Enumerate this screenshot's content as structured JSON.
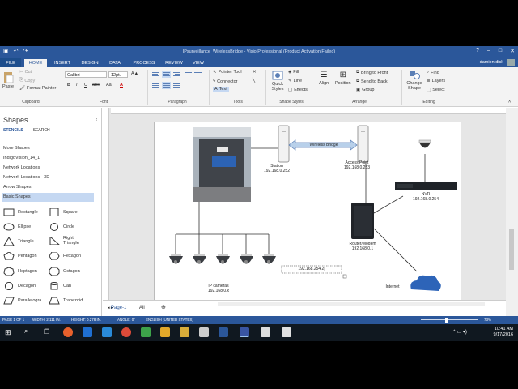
{
  "window": {
    "title": "IPsurveillance_WirelessBridge - Visio Professional (Product Activation Failed)"
  },
  "tabs": [
    "FILE",
    "HOME",
    "INSERT",
    "DESIGN",
    "DATA",
    "PROCESS",
    "REVIEW",
    "VIEW"
  ],
  "user": "damion dick",
  "ribbon": {
    "clipboard": {
      "paste": "Paste",
      "cut": "Cut",
      "copy": "Copy",
      "format_painter": "Format Painter",
      "label": "Clipboard"
    },
    "font": {
      "family": "Calibri",
      "size": "12pt.",
      "bold": "B",
      "italic": "I",
      "underline": "U",
      "strike": "abc",
      "case": "Aa",
      "color": "A",
      "label": "Font"
    },
    "paragraph": {
      "label": "Paragraph"
    },
    "tools": {
      "pointer": "Pointer Tool",
      "connector": "Connector",
      "text": "Text",
      "label": "Tools"
    },
    "shape_styles": {
      "quick_styles": "Quick Styles",
      "fill": "Fill",
      "line": "Line",
      "effects": "Effects",
      "label": "Shape Styles"
    },
    "arrange": {
      "align": "Align",
      "position": "Position",
      "bring_front": "Bring to Front",
      "send_back": "Send to Back",
      "group": "Group",
      "label": "Arrange"
    },
    "editing": {
      "change_shape": "Change Shape",
      "find": "Find",
      "layers": "Layers",
      "select": "Select",
      "label": "Editing"
    }
  },
  "pane": {
    "title": "Shapes",
    "tab_stencils": "STENCILS",
    "tab_search": "SEARCH",
    "stencils": [
      "More Shapes",
      "IndigoVision_14_1",
      "Network Locations",
      "Network Locations - 3D",
      "Arrow Shapes",
      "Basic Shapes"
    ],
    "shapes": [
      [
        "Rectangle",
        "Square"
      ],
      [
        "Ellipse",
        "Circle"
      ],
      [
        "Triangle",
        "Right Triangle"
      ],
      [
        "Pentagon",
        "Hexagon"
      ],
      [
        "Heptagon",
        "Octagon"
      ],
      [
        "Decagon",
        "Can"
      ],
      [
        "Parallelogra...",
        "Trapezoid"
      ]
    ]
  },
  "diagram": {
    "station_label": "Station",
    "station_ip": "192.168.0.252",
    "bridge_label": "Wireless Bridge",
    "ap_label": "Access Point",
    "ap_ip": "192.168.0.253",
    "nvr_label": "NVR",
    "nvr_ip": "192.168.0.254",
    "router_label": "Router/Modem",
    "router_ip": "192.168.0.1",
    "cameras_label": "IP cameras",
    "cameras_ip": "192.168.0.x",
    "textbox": "192.168.254.2|",
    "internet": "Internet"
  },
  "pagebar": {
    "page": "Page-1",
    "all": "All"
  },
  "status": {
    "page": "PAGE 1 OF 1",
    "width": "WIDTH: 2.111 IN.",
    "height": "HEIGHT: 0.278 IN.",
    "angle": "ANGLE: 0°",
    "language": "ENGLISH (UNITED STATES)",
    "zoom": "73%"
  },
  "clock": {
    "time": "10:41 AM",
    "date": "9/17/2016"
  },
  "colors": {
    "accent": "#2b579a",
    "selection": "#c5d8f2"
  }
}
